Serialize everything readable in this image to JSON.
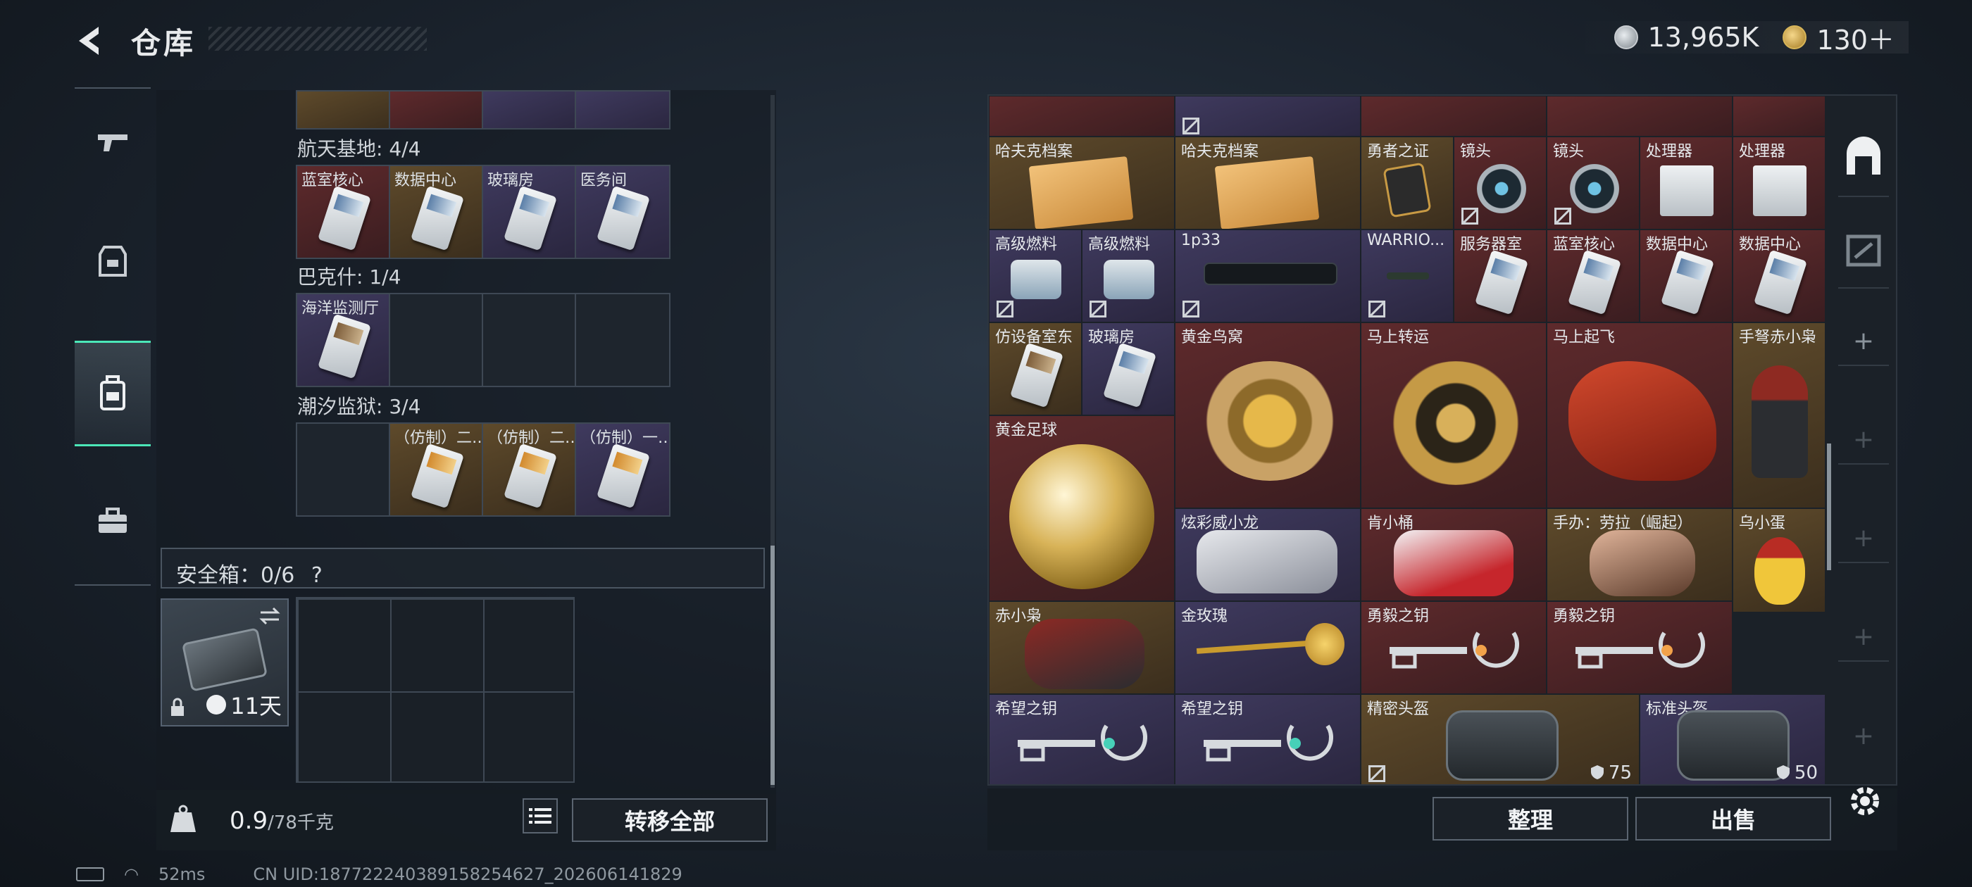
{
  "header": {
    "title": "仓库",
    "currency1": "13,965K",
    "currency2": "130＋"
  },
  "left_nav": [
    "gun-icon",
    "armor-icon",
    "backpack-icon",
    "toolbox-icon"
  ],
  "sections": [
    {
      "label": "航天基地: 4/4",
      "cells": [
        "蓝室核心",
        "数据中心",
        "玻璃房",
        "医务间"
      ]
    },
    {
      "label": "巴克什: 1/4",
      "cells": [
        "海洋监测厅",
        "",
        "",
        ""
      ]
    },
    {
      "label": "潮汐监狱: 3/4",
      "cells": [
        "",
        "（仿制）二…",
        "（仿制）二…",
        "（仿制）一…"
      ]
    }
  ],
  "safebox": {
    "label": "安全箱：0/6",
    "help": "?",
    "days": "11天"
  },
  "weight": {
    "value": "0.9",
    "unit": "/78千克"
  },
  "buttons": {
    "transfer_all": "转移全部",
    "sort": "整理",
    "sell": "出售"
  },
  "items": [
    {
      "name": "哈夫克档案"
    },
    {
      "name": "哈夫克档案"
    },
    {
      "name": "勇者之证"
    },
    {
      "name": "镜头"
    },
    {
      "name": "镜头"
    },
    {
      "name": "处理器"
    },
    {
      "name": "处理器"
    },
    {
      "name": "高级燃料"
    },
    {
      "name": "高级燃料"
    },
    {
      "name": "1p33"
    },
    {
      "name": "WARRIO..."
    },
    {
      "name": "服务器室"
    },
    {
      "name": "蓝室核心"
    },
    {
      "name": "数据中心"
    },
    {
      "name": "数据中心"
    },
    {
      "name": "仿设备室东"
    },
    {
      "name": "玻璃房"
    },
    {
      "name": "黄金鸟窝"
    },
    {
      "name": "马上转运"
    },
    {
      "name": "马上起飞"
    },
    {
      "name": "手弩赤小枭"
    },
    {
      "name": "黄金足球"
    },
    {
      "name": "炫彩威小龙"
    },
    {
      "name": "肯小桶"
    },
    {
      "name": "手办：劳拉（崛起）"
    },
    {
      "name": "乌小蛋"
    },
    {
      "name": "赤小枭"
    },
    {
      "name": "金玫瑰"
    },
    {
      "name": "勇毅之钥"
    },
    {
      "name": "勇毅之钥"
    },
    {
      "name": "希望之钥"
    },
    {
      "name": "希望之钥"
    },
    {
      "name": "精密头盔",
      "count": "75"
    },
    {
      "name": "标准头盔",
      "count": "50"
    }
  ],
  "status": {
    "ping": "52ms",
    "uid": "CN UID:18772224038915825462​7_202606141829"
  }
}
